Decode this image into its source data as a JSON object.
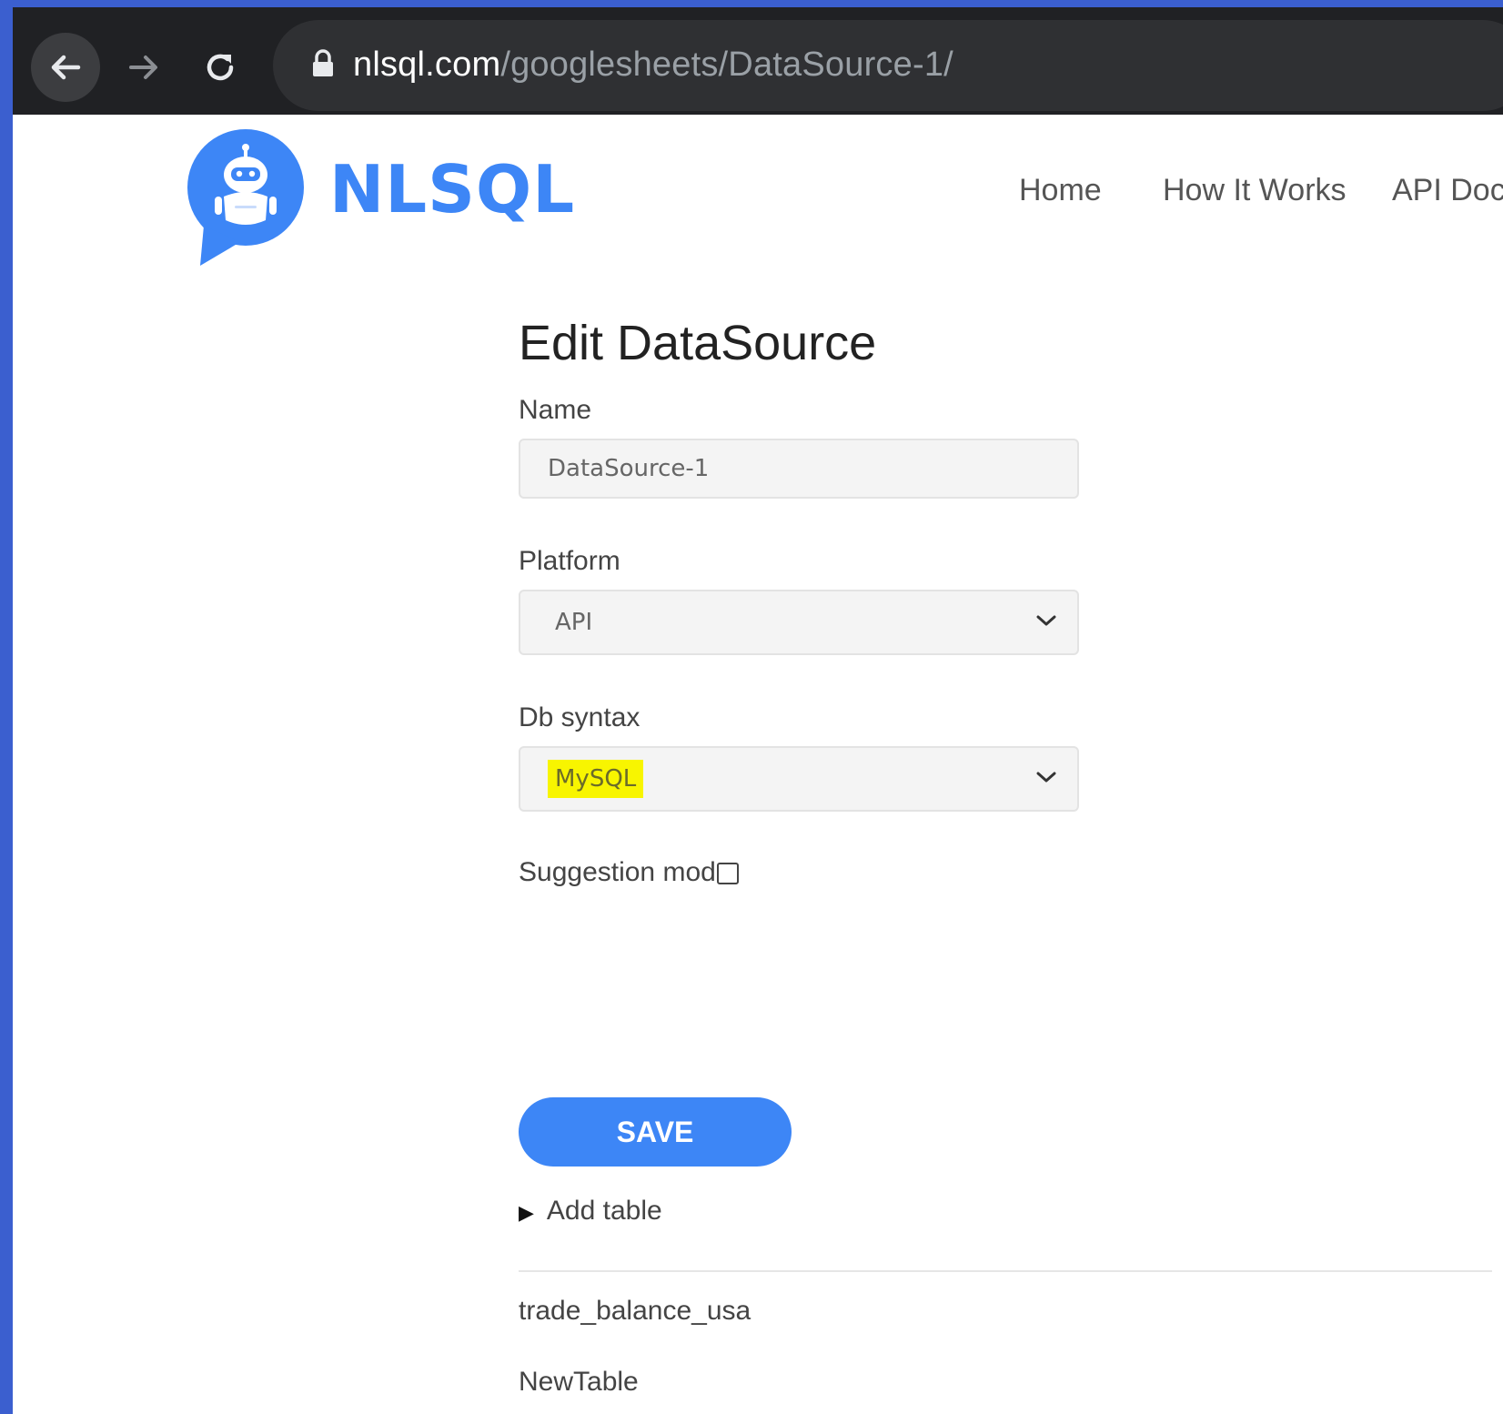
{
  "browser": {
    "url_host": "nlsql.com",
    "url_path": "/googlesheets/DataSource-1/"
  },
  "brand": {
    "name": "NLSQL"
  },
  "nav": {
    "home": "Home",
    "how_it_works": "How It Works",
    "api_docs": "API Docu"
  },
  "form": {
    "title": "Edit DataSource",
    "name_label": "Name",
    "name_value": "DataSource-1",
    "platform_label": "Platform",
    "platform_value": "API",
    "db_syntax_label": "Db syntax",
    "db_syntax_value": "MySQL",
    "suggestion_label": "Suggestion mode",
    "save_label": "SAVE",
    "add_table_label": "Add table"
  },
  "tables": [
    "trade_balance_usa",
    "NewTable"
  ],
  "colors": {
    "accent": "#3d86f6",
    "highlight": "#f8f500",
    "chrome": "#202124"
  }
}
